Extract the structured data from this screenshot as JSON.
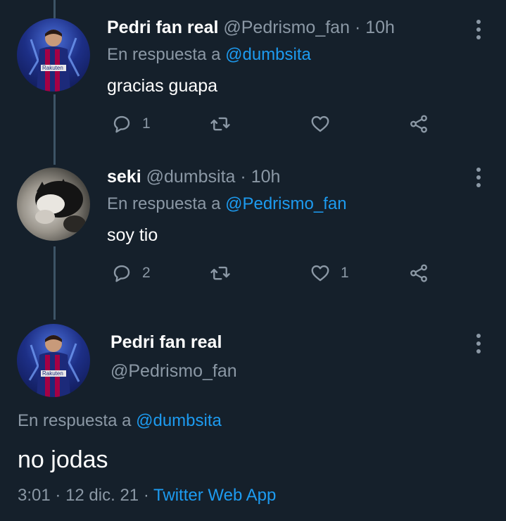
{
  "tweets": [
    {
      "display_name": "Pedri fan real",
      "handle": "@Pedrismo_fan",
      "separator": "·",
      "time": "10h",
      "reply_prefix": "En respuesta a",
      "reply_to": "@dumbsita",
      "text": "gracias guapa",
      "reply_count": "1",
      "retweet_count": "",
      "like_count": ""
    },
    {
      "display_name": "seki",
      "handle": "@dumbsita",
      "separator": "·",
      "time": "10h",
      "reply_prefix": "En respuesta a",
      "reply_to": "@Pedrismo_fan",
      "text": "soy tio",
      "reply_count": "2",
      "retweet_count": "",
      "like_count": "1"
    }
  ],
  "focused": {
    "display_name": "Pedri fan real",
    "handle": "@Pedrismo_fan",
    "reply_prefix": "En respuesta a",
    "reply_to": "@dumbsita",
    "text": "no jodas",
    "time": "3:01",
    "dot1": "·",
    "date": "12 dic. 21",
    "dot2": "·",
    "source": "Twitter Web App"
  },
  "icons": {
    "reply": "reply-icon",
    "retweet": "retweet-icon",
    "like": "heart-icon",
    "share": "share-icon",
    "more": "more-vertical-icon"
  },
  "colors": {
    "background": "#15202b",
    "accent": "#1d9bf0",
    "secondary_text": "#8b98a5",
    "thread_line": "#3d5466"
  }
}
